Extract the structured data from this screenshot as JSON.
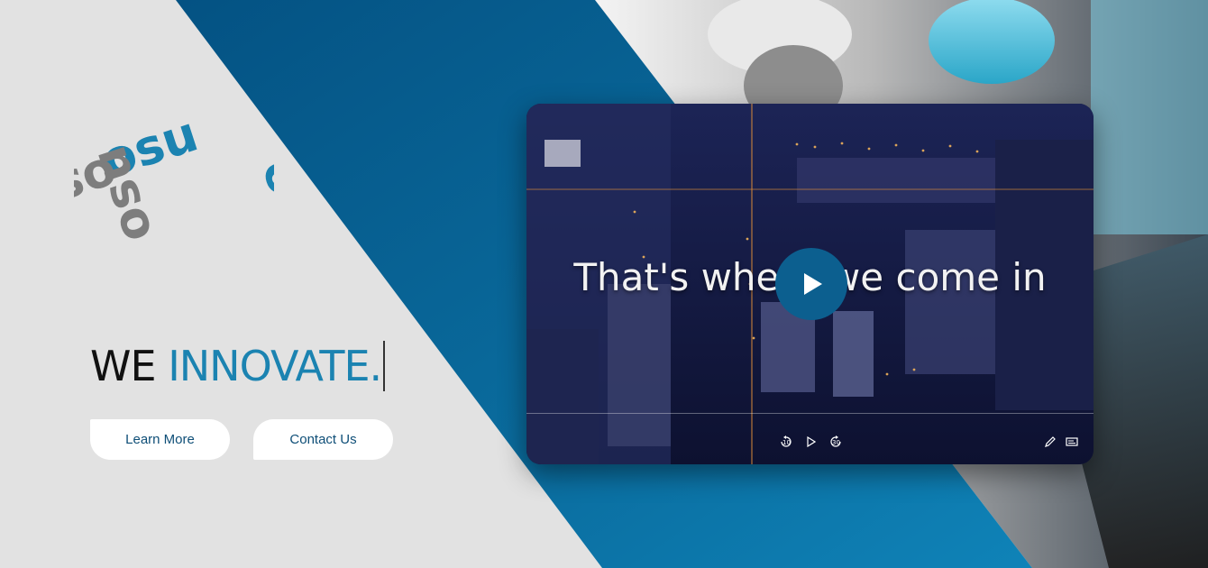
{
  "hero": {
    "headline_prefix": "WE",
    "headline_accent": "INNOVATE.",
    "buttons": {
      "learn_more": "Learn More",
      "contact_us": "Contact Us"
    }
  },
  "logo": {
    "mark_text": "osu",
    "colors": {
      "blue": "#1b83b1",
      "gray": "#7d7d7d"
    }
  },
  "video": {
    "caption": "That's where we come in",
    "controls": {
      "rewind_label": "10",
      "forward_label": "30",
      "icons": [
        "rewind-10-icon",
        "play-icon",
        "forward-30-icon",
        "pencil-icon",
        "captions-icon"
      ]
    }
  },
  "colors": {
    "background": "#e2e2e2",
    "dark_blue": "#0c5f8f",
    "light_blue": "#1b83b1",
    "button_text": "#0e4e77"
  }
}
